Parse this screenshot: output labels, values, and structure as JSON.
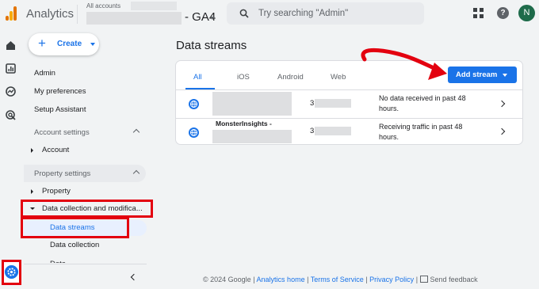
{
  "app": {
    "title": "Analytics",
    "account_label": "All accounts",
    "property_name": "- GA4"
  },
  "search": {
    "placeholder": "Try searching \"Admin\""
  },
  "user": {
    "avatar_initial": "N"
  },
  "icons": {
    "logo": "google-analytics-logo",
    "search": "search-icon",
    "apps": "apps-grid-icon",
    "help": "help-icon",
    "rail": [
      "home-icon",
      "reports-icon",
      "explore-icon",
      "advertising-icon",
      "admin-gear-icon"
    ],
    "stream": "globe-icon"
  },
  "nav": {
    "create_label": "Create",
    "links": [
      "Admin",
      "My preferences",
      "Setup Assistant"
    ],
    "account_settings": {
      "label": "Account settings",
      "items": [
        "Account"
      ]
    },
    "property_settings": {
      "label": "Property settings",
      "items": [
        "Property",
        "Data collection and modifica...",
        "Data streams",
        "Data collection"
      ]
    }
  },
  "main": {
    "title": "Data streams",
    "tabs": [
      "All",
      "iOS",
      "Android",
      "Web"
    ],
    "active_tab": "All",
    "add_stream_label": "Add stream",
    "streams": [
      {
        "name": "",
        "id_prefix": "3",
        "status": "No data received in past 48 hours."
      },
      {
        "name": "MonsterInsights -",
        "id_prefix": "3",
        "status": "Receiving traffic in past 48 hours."
      }
    ]
  },
  "footer": {
    "copyright": "© 2024 Google",
    "links": [
      "Analytics home",
      "Terms of Service",
      "Privacy Policy"
    ],
    "feedback": "Send feedback"
  },
  "colors": {
    "accent": "#1a73e8",
    "highlight_red": "#e3000f",
    "avatar_bg": "#1e6b4a",
    "background": "#f1f3f4"
  }
}
